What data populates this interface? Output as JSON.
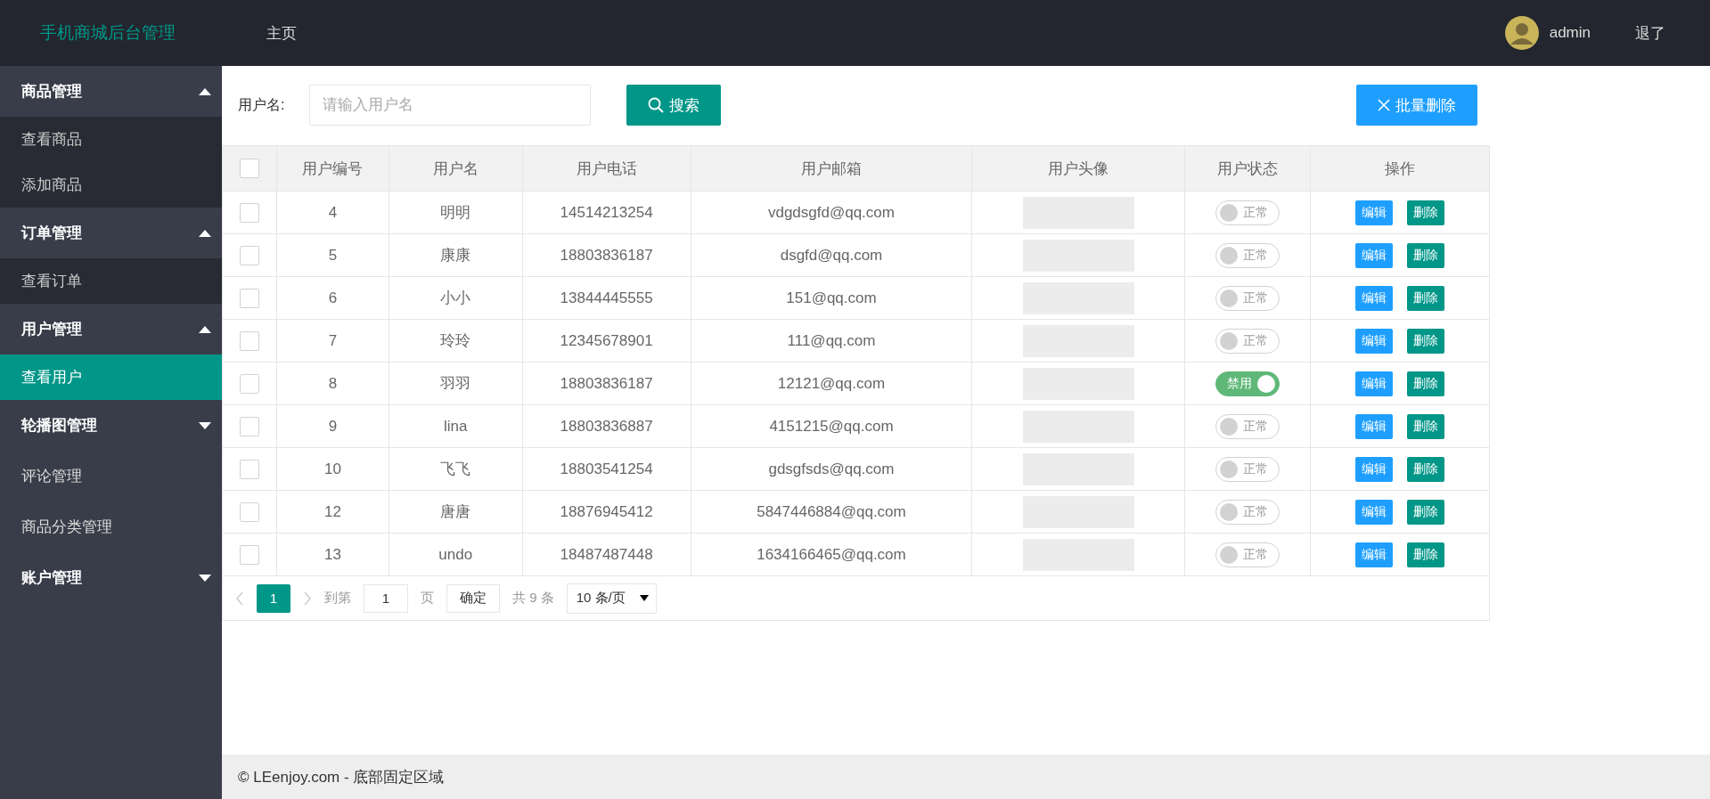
{
  "header": {
    "logo": "手机商城后台管理",
    "nav": [
      {
        "label": "主页"
      }
    ],
    "user": {
      "name": "admin"
    },
    "logout": "退了"
  },
  "sidebar": {
    "items": [
      {
        "kind": "group",
        "label": "商品管理",
        "expanded": true,
        "children": [
          {
            "label": "查看商品",
            "selected": false
          },
          {
            "label": "添加商品",
            "selected": false
          }
        ]
      },
      {
        "kind": "group",
        "label": "订单管理",
        "expanded": true,
        "children": [
          {
            "label": "查看订单",
            "selected": false
          }
        ]
      },
      {
        "kind": "group",
        "label": "用户管理",
        "expanded": true,
        "children": [
          {
            "label": "查看用户",
            "selected": true
          }
        ]
      },
      {
        "kind": "group",
        "label": "轮播图管理",
        "expanded": false
      },
      {
        "kind": "item",
        "label": "评论管理"
      },
      {
        "kind": "item",
        "label": "商品分类管理"
      },
      {
        "kind": "group",
        "label": "账户管理",
        "expanded": false
      }
    ]
  },
  "search": {
    "label": "用户名:",
    "placeholder": "请输入用户名",
    "button": "搜索"
  },
  "bulk_delete": "批量删除",
  "table": {
    "select_all_checked": false,
    "columns": [
      "用户编号",
      "用户名",
      "用户电话",
      "用户邮箱",
      "用户头像",
      "用户状态",
      "操作"
    ],
    "rows": [
      {
        "checked": false,
        "id": "4",
        "name": "明明",
        "phone": "14514213254",
        "email": "vdgdsgfd@qq.com",
        "status": "正常",
        "on": false,
        "edit": "编辑",
        "delete": "删除"
      },
      {
        "checked": false,
        "id": "5",
        "name": "康康",
        "phone": "18803836187",
        "email": "dsgfd@qq.com",
        "status": "正常",
        "on": false,
        "edit": "编辑",
        "delete": "删除"
      },
      {
        "checked": false,
        "id": "6",
        "name": "小小",
        "phone": "13844445555",
        "email": "151@qq.com",
        "status": "正常",
        "on": false,
        "edit": "编辑",
        "delete": "删除"
      },
      {
        "checked": false,
        "id": "7",
        "name": "玲玲",
        "phone": "12345678901",
        "email": "111@qq.com",
        "status": "正常",
        "on": false,
        "edit": "编辑",
        "delete": "删除"
      },
      {
        "checked": false,
        "id": "8",
        "name": "羽羽",
        "phone": "18803836187",
        "email": "12121@qq.com",
        "status": "禁用",
        "on": true,
        "edit": "编辑",
        "delete": "删除"
      },
      {
        "checked": false,
        "id": "9",
        "name": "lina",
        "phone": "18803836887",
        "email": "4151215@qq.com",
        "status": "正常",
        "on": false,
        "edit": "编辑",
        "delete": "删除"
      },
      {
        "checked": false,
        "id": "10",
        "name": "飞飞",
        "phone": "18803541254",
        "email": "gdsgfsds@qq.com",
        "status": "正常",
        "on": false,
        "edit": "编辑",
        "delete": "删除"
      },
      {
        "checked": false,
        "id": "12",
        "name": "唐唐",
        "phone": "18876945412",
        "email": "5847446884@qq.com",
        "status": "正常",
        "on": false,
        "edit": "编辑",
        "delete": "删除"
      },
      {
        "checked": false,
        "id": "13",
        "name": "undo",
        "phone": "18487487448",
        "email": "1634166465@qq.com",
        "status": "正常",
        "on": false,
        "edit": "编辑",
        "delete": "删除"
      }
    ]
  },
  "pagination": {
    "pages": [
      {
        "label": "1",
        "selected": true
      }
    ],
    "goto_label": "到第",
    "goto_value": "1",
    "page_unit": "页",
    "confirm": "确定",
    "total": "共 9 条",
    "page_size": "10 条/页"
  },
  "footer": {
    "text": "© LEenjoy.com - 底部固定区域"
  }
}
